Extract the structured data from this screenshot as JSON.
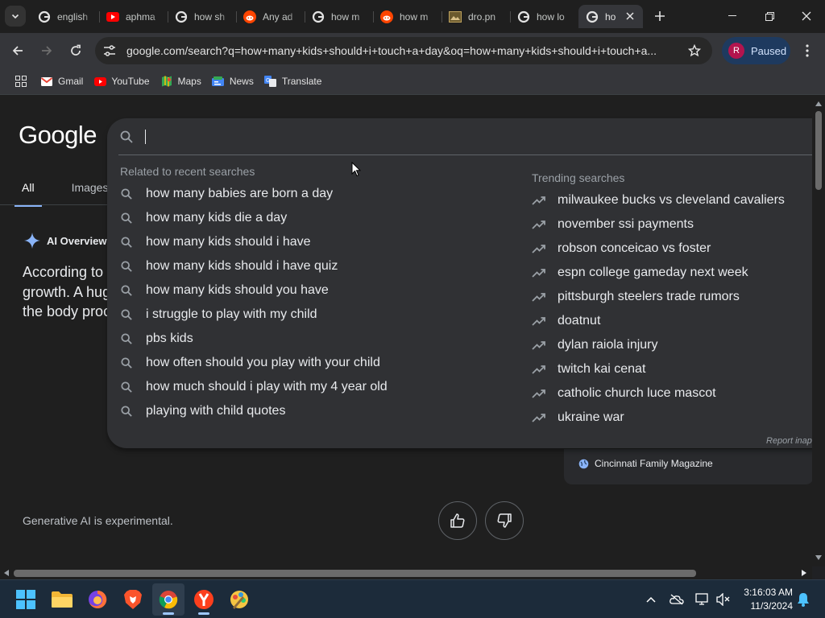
{
  "browser": {
    "tabs": [
      {
        "title": "english",
        "icon": "google-icon"
      },
      {
        "title": "aphma",
        "icon": "youtube-icon"
      },
      {
        "title": "how sh",
        "icon": "google-icon"
      },
      {
        "title": "Any ad",
        "icon": "reddit-icon"
      },
      {
        "title": "how m",
        "icon": "google-icon"
      },
      {
        "title": "how m",
        "icon": "reddit-icon"
      },
      {
        "title": "dro.pn",
        "icon": "image-file-icon"
      },
      {
        "title": "how lo",
        "icon": "google-icon"
      },
      {
        "title": "ho",
        "icon": "google-icon",
        "active": true
      }
    ],
    "address_bar": {
      "url": "google.com/search?q=how+many+kids+should+i+touch+a+day&oq=how+many+kids+should+i+touch+a..."
    },
    "profile": {
      "initial": "R",
      "label": "Paused"
    },
    "bookmarks": [
      {
        "label": "Gmail",
        "icon": "gmail-icon"
      },
      {
        "label": "YouTube",
        "icon": "youtube-icon"
      },
      {
        "label": "Maps",
        "icon": "maps-icon"
      },
      {
        "label": "News",
        "icon": "news-icon"
      },
      {
        "label": "Translate",
        "icon": "translate-icon"
      }
    ]
  },
  "google": {
    "logo": "Google",
    "tabs": [
      "All",
      "Images"
    ],
    "ai_overview": {
      "heading": "AI Overview",
      "lines": [
        "According to",
        "growth. A hug",
        "the body proc"
      ]
    },
    "source_name": "Cincinnati Family Magazine",
    "disclaimer": "Generative AI is experimental."
  },
  "search_dropdown": {
    "query": "",
    "related_title": "Related to recent searches",
    "related": [
      "how many babies are born a day",
      "how many kids die a day",
      "how many kids should i have",
      "how many kids should i have quiz",
      "how many kids should you have",
      "i struggle to play with my child",
      "pbs kids",
      "how often should you play with your child",
      "how much should i play with my 4 year old",
      "playing with child quotes"
    ],
    "trending_title": "Trending searches",
    "trending": [
      "milwaukee bucks vs cleveland cavaliers",
      "november ssi payments",
      "robson conceicao vs foster",
      "espn college gameday next week",
      "pittsburgh steelers trade rumors",
      "doatnut",
      "dylan raiola injury",
      "twitch kai cenat",
      "catholic church luce mascot",
      "ukraine war"
    ],
    "report_label": "Report inap"
  },
  "taskbar": {
    "apps": [
      "windows-start-icon",
      "file-explorer-icon",
      "firefox-icon",
      "brave-icon",
      "chrome-icon",
      "yandex-icon",
      "paint-icon"
    ],
    "time": "3:16:03 AM",
    "date": "11/3/2024"
  },
  "colors": {
    "page_bg": "#1f1f1f",
    "dropdown_bg": "#303134",
    "accent": "#8ab4f8",
    "profile_bg": "#1e3a5f"
  }
}
